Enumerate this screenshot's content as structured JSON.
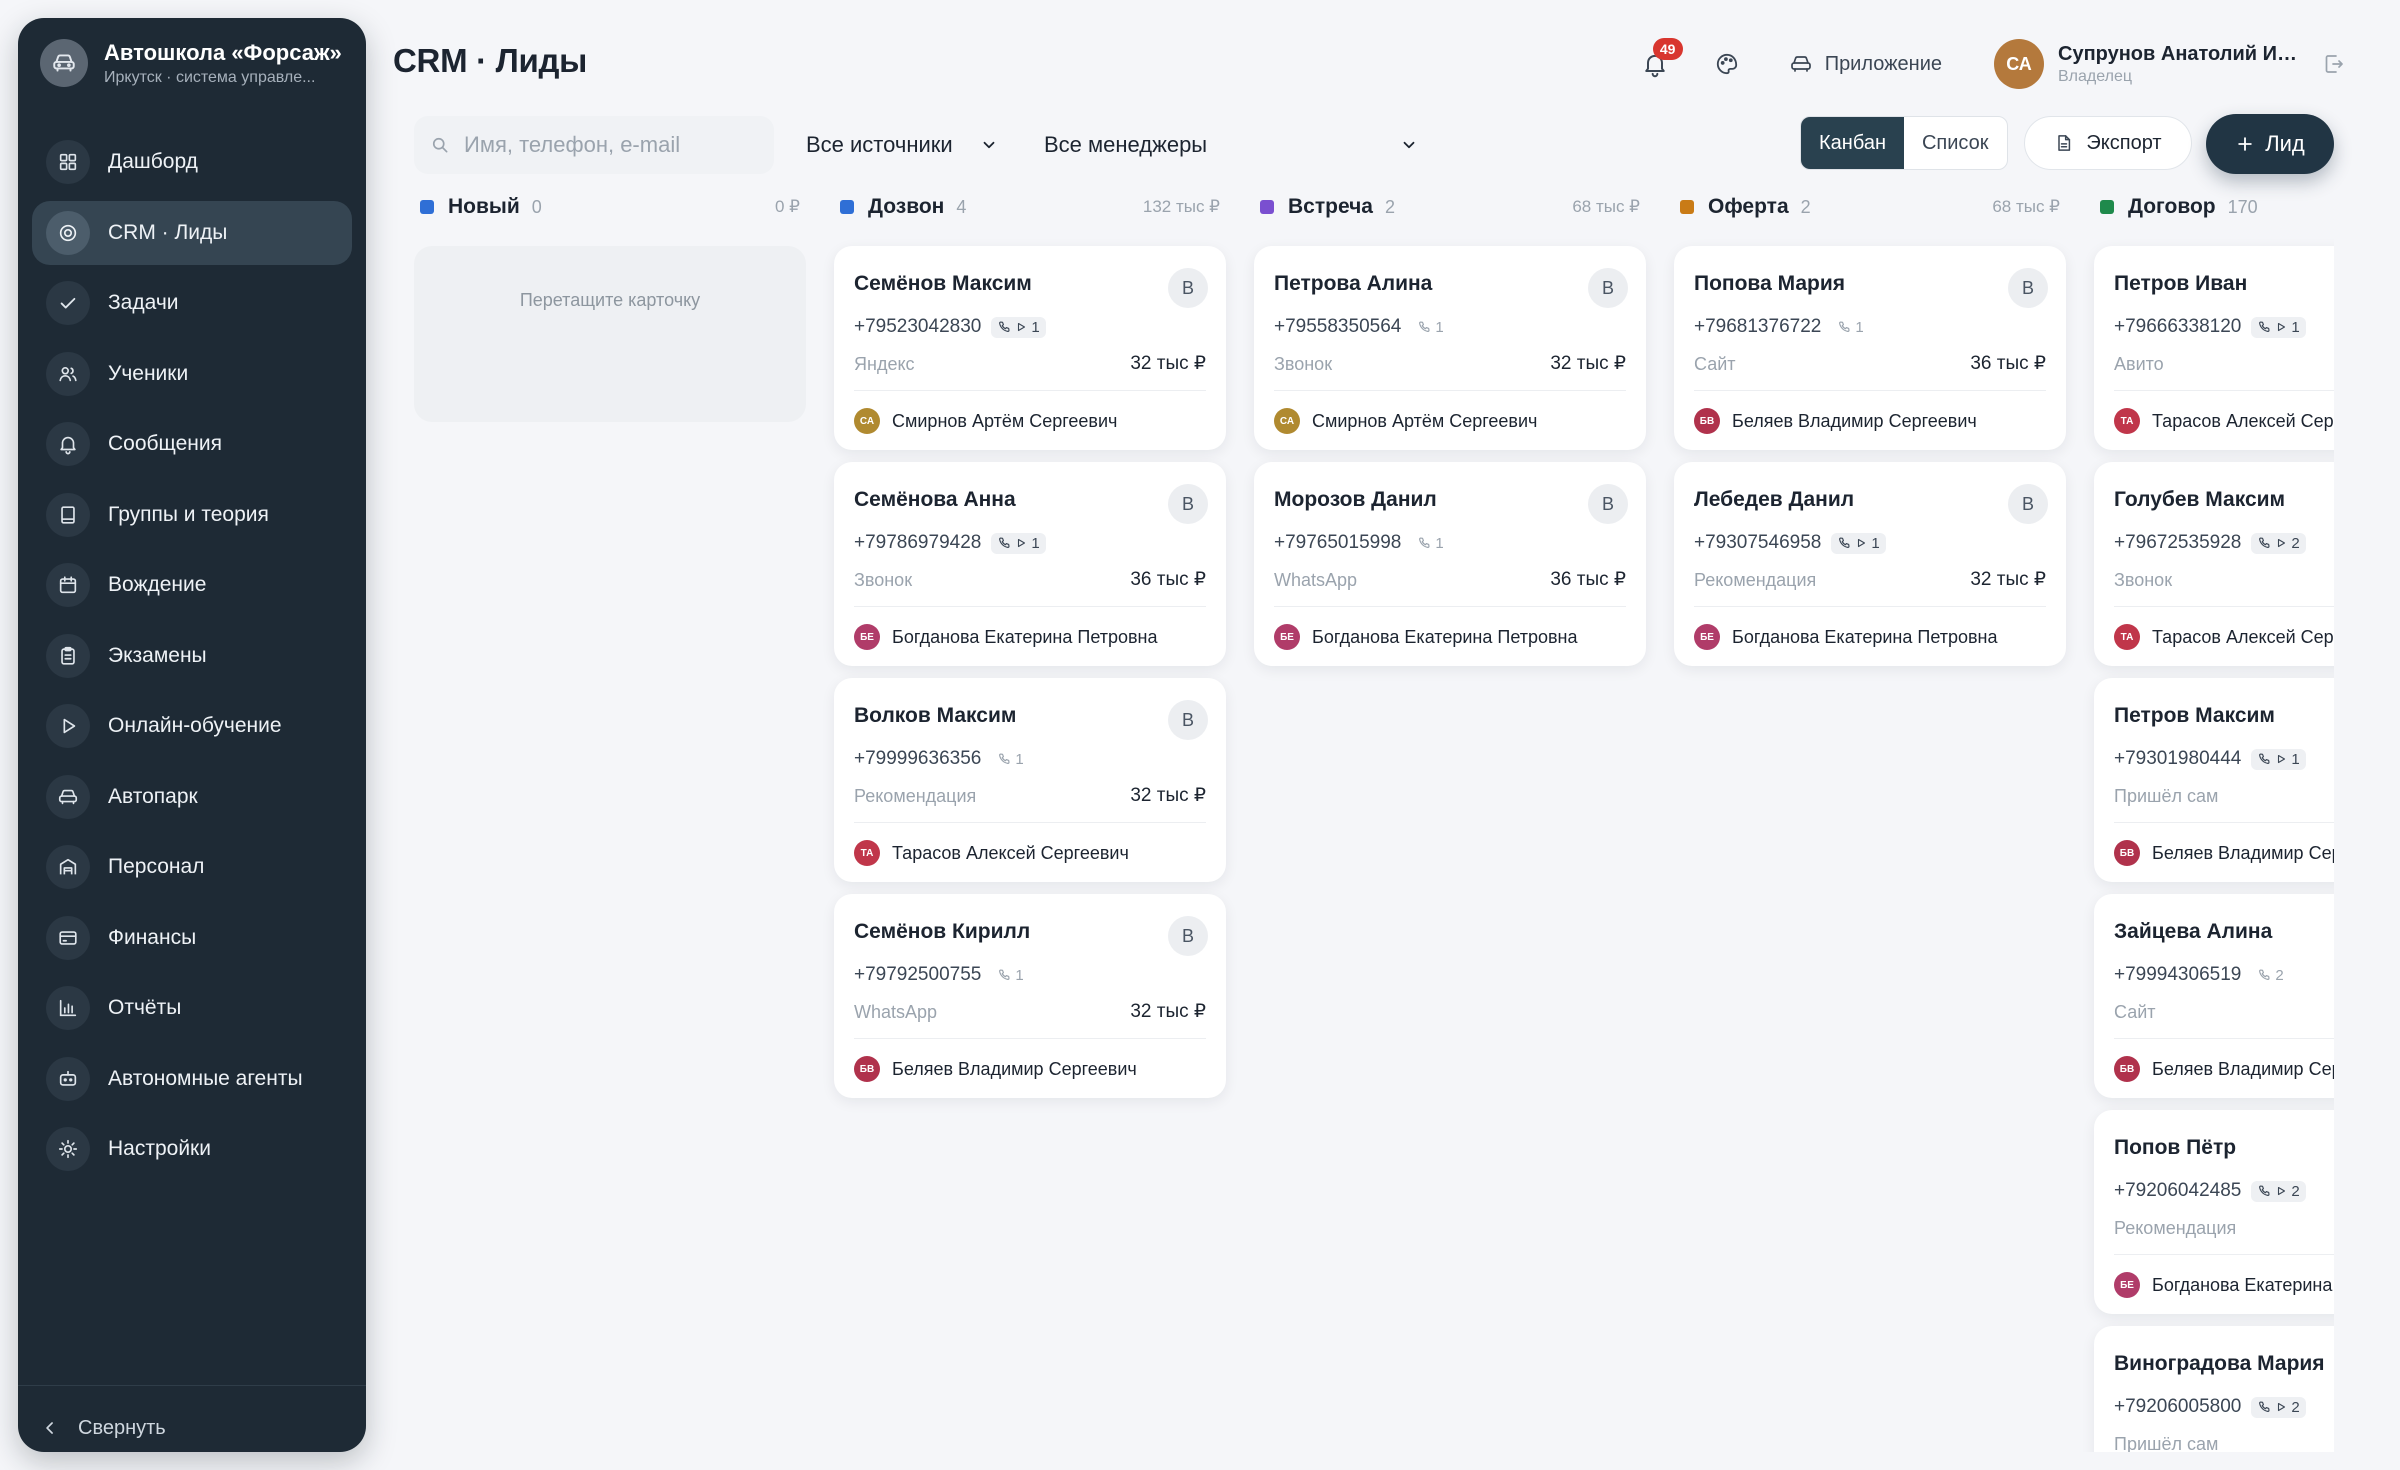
{
  "brand": {
    "name": "Автошкола «Форсаж»",
    "subtitle": "Иркутск · система управле..."
  },
  "sidebar": {
    "items": [
      {
        "label": "Дашборд",
        "icon": "grid-icon",
        "active": false
      },
      {
        "label": "CRM · Лиды",
        "icon": "target-icon",
        "active": true
      },
      {
        "label": "Задачи",
        "icon": "check-icon",
        "active": false
      },
      {
        "label": "Ученики",
        "icon": "users-icon",
        "active": false
      },
      {
        "label": "Сообщения",
        "icon": "bell-icon",
        "active": false
      },
      {
        "label": "Группы и теория",
        "icon": "book-icon",
        "active": false
      },
      {
        "label": "Вождение",
        "icon": "calendar-icon",
        "active": false
      },
      {
        "label": "Экзамены",
        "icon": "clipboard-icon",
        "active": false
      },
      {
        "label": "Онлайн-обучение",
        "icon": "play-icon",
        "active": false
      },
      {
        "label": "Автопарк",
        "icon": "car-icon",
        "active": false
      },
      {
        "label": "Персонал",
        "icon": "building-icon",
        "active": false
      },
      {
        "label": "Финансы",
        "icon": "wallet-icon",
        "active": false
      },
      {
        "label": "Отчёты",
        "icon": "bar-chart-icon",
        "active": false
      },
      {
        "label": "Автономные агенты",
        "icon": "bot-icon",
        "active": false
      },
      {
        "label": "Настройки",
        "icon": "sun-gear-icon",
        "active": false
      }
    ],
    "collapse_label": "Свернуть"
  },
  "header": {
    "title": "CRM · Лиды",
    "notifications_count": "49",
    "app_label": "Приложение",
    "user": {
      "initials": "СА",
      "name": "Супрунов Анатолий Ив...",
      "role": "Владелец"
    }
  },
  "filters": {
    "search_placeholder": "Имя, телефон, e-mail",
    "source_select": "Все источники",
    "manager_select": "Все менеджеры",
    "view_kanban": "Канбан",
    "view_list": "Список",
    "export_label": "Экспорт",
    "add_lead_label": "Лид"
  },
  "colors": {
    "new": "#2f6fd6",
    "call": "#2f6fd6",
    "meeting": "#7a4fd0",
    "offer": "#c97b16",
    "contract": "#1f8a4c"
  },
  "managers": {
    "smirnov": {
      "initials": "СА",
      "name": "Смирнов Артём Сергеевич",
      "color": "#b08a30"
    },
    "bogdanova": {
      "initials": "БЕ",
      "name": "Богданова Екатерина Петровна",
      "color": "#b03c69"
    },
    "tarasov": {
      "initials": "ТА",
      "name": "Тарасов Алексей Сергеевич",
      "color": "#c0364a"
    },
    "belyaev": {
      "initials": "БВ",
      "name": "Беляев Владимир Сергеевич",
      "color": "#b0324c"
    }
  },
  "board": {
    "columns": [
      {
        "key": "new",
        "title": "Новый",
        "count": "0",
        "sum": "0 ₽",
        "empty_text": "Перетащите карточку",
        "cards": []
      },
      {
        "key": "call",
        "title": "Дозвон",
        "count": "4",
        "sum": "132 тыс ₽",
        "cards": [
          {
            "name": "Семёнов Максим",
            "badge": "В",
            "phone": "+79523042830",
            "play": true,
            "calls": "1",
            "source": "Яндекс",
            "price": "32 тыс ₽",
            "manager": "smirnov"
          },
          {
            "name": "Семёнова Анна",
            "badge": "В",
            "phone": "+79786979428",
            "play": true,
            "calls": "1",
            "source": "Звонок",
            "price": "36 тыс ₽",
            "manager": "bogdanova"
          },
          {
            "name": "Волков Максим",
            "badge": "В",
            "phone": "+79999636356",
            "play": false,
            "calls": "1",
            "source": "Рекомендация",
            "price": "32 тыс ₽",
            "manager": "tarasov"
          },
          {
            "name": "Семёнов Кирилл",
            "badge": "В",
            "phone": "+79792500755",
            "play": false,
            "calls": "1",
            "source": "WhatsApp",
            "price": "32 тыс ₽",
            "manager": "belyaev"
          }
        ]
      },
      {
        "key": "meeting",
        "title": "Встреча",
        "count": "2",
        "sum": "68 тыс ₽",
        "cards": [
          {
            "name": "Петрова Алина",
            "badge": "В",
            "phone": "+79558350564",
            "play": false,
            "calls": "1",
            "source": "Звонок",
            "price": "32 тыс ₽",
            "manager": "smirnov"
          },
          {
            "name": "Морозов Данил",
            "badge": "В",
            "phone": "+79765015998",
            "play": false,
            "calls": "1",
            "source": "WhatsApp",
            "price": "36 тыс ₽",
            "manager": "bogdanova"
          }
        ]
      },
      {
        "key": "offer",
        "title": "Оферта",
        "count": "2",
        "sum": "68 тыс ₽",
        "cards": [
          {
            "name": "Попова Мария",
            "badge": "В",
            "phone": "+79681376722",
            "play": false,
            "calls": "1",
            "source": "Сайт",
            "price": "36 тыс ₽",
            "manager": "belyaev"
          },
          {
            "name": "Лебедев Данил",
            "badge": "В",
            "phone": "+79307546958",
            "play": true,
            "calls": "1",
            "source": "Рекомендация",
            "price": "32 тыс ₽",
            "manager": "bogdanova"
          }
        ]
      },
      {
        "key": "contract",
        "title": "Договор",
        "count": "170",
        "sum": "",
        "cards": [
          {
            "name": "Петров Иван",
            "badge": "",
            "phone": "+79666338120",
            "play": true,
            "calls": "1",
            "source": "Авито",
            "price": "",
            "manager": "tarasov"
          },
          {
            "name": "Голубев Максим",
            "badge": "",
            "phone": "+79672535928",
            "play": true,
            "calls": "2",
            "source": "Звонок",
            "price": "",
            "manager": "tarasov"
          },
          {
            "name": "Петров Максим",
            "badge": "",
            "phone": "+79301980444",
            "play": true,
            "calls": "1",
            "source": "Пришёл сам",
            "price": "",
            "manager": "belyaev"
          },
          {
            "name": "Зайцева Алина",
            "badge": "",
            "phone": "+79994306519",
            "play": false,
            "calls": "2",
            "source": "Сайт",
            "price": "",
            "manager": "belyaev"
          },
          {
            "name": "Попов Пётр",
            "badge": "",
            "phone": "+79206042485",
            "play": true,
            "calls": "2",
            "source": "Рекомендация",
            "price": "",
            "manager": "bogdanova"
          },
          {
            "name": "Виноградова Мария",
            "badge": "",
            "phone": "+79206005800",
            "play": true,
            "calls": "2",
            "source": "Пришёл сам",
            "price": "",
            "manager": ""
          }
        ]
      }
    ]
  }
}
